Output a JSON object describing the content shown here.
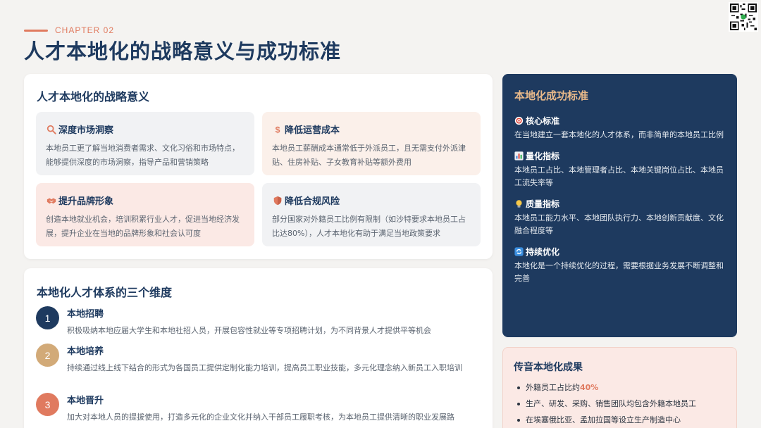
{
  "header": {
    "chapter": "CHAPTER 02",
    "title": "人才本地化的战略意义与成功标准"
  },
  "strategy": {
    "title": "人才本地化的战略意义",
    "tiles": [
      {
        "icon": "magnifier-icon",
        "title": "深度市场洞察",
        "desc": "本地员工更了解当地消费者需求、文化习俗和市场特点，能够提供深度的市场洞察，指导产品和营销策略"
      },
      {
        "icon": "dollar-icon",
        "title": "降低运营成本",
        "desc": "本地员工薪酬成本通常低于外派员工，且无需支付外派津贴、住房补贴、子女教育补贴等额外费用"
      },
      {
        "icon": "handshake-icon",
        "title": "提升品牌形象",
        "desc": "创造本地就业机会，培训积累行业人才，促进当地经济发展，提升企业在当地的品牌形象和社会认可度"
      },
      {
        "icon": "shield-icon",
        "title": "降低合规风险",
        "desc": "部分国家对外籍员工比例有限制（如沙特要求本地员工占比达80%），人才本地化有助于满足当地政策要求"
      }
    ]
  },
  "dimensions": {
    "title": "本地化人才体系的三个维度",
    "items": [
      {
        "num": "1",
        "title": "本地招聘",
        "desc": "积极吸纳本地应届大学生和本地社招人员，开展包容性就业等专项招聘计划，为不同背景人才提供平等机会"
      },
      {
        "num": "2",
        "title": "本地培养",
        "desc": "持续通过线上线下结合的形式为各国员工提供定制化能力培训，提高员工职业技能，多元化理念纳入新员工入职培训"
      },
      {
        "num": "3",
        "title": "本地晋升",
        "desc": "加大对本地人员的提拔使用，打造多元化的企业文化并纳入干部员工履职考核，为本地员工提供清晰的职业发展路"
      }
    ]
  },
  "standards": {
    "title": "本地化成功标准",
    "items": [
      {
        "icon": "target-icon",
        "title": "核心标准",
        "desc": "在当地建立一套本地化的人才体系，而非简单的本地员工比例"
      },
      {
        "icon": "bar-chart-icon",
        "title": "量化指标",
        "desc": "本地员工占比、本地管理者占比、本地关键岗位占比、本地员工流失率等"
      },
      {
        "icon": "lightbulb-icon",
        "title": "质量指标",
        "desc": "本地员工能力水平、本地团队执行力、本地创新贡献度、文化融合程度等"
      },
      {
        "icon": "refresh-icon",
        "title": "持续优化",
        "desc": "本地化是一个持续优化的过程，需要根据业务发展不断调整和完善"
      }
    ]
  },
  "achievements": {
    "title": "传音本地化成果",
    "item1_prefix": "外籍员工占比约",
    "item1_value": "40%",
    "item2": "生产、研发、采购、销售团队均包含外籍本地员工",
    "item3": "在埃塞俄比亚、孟加拉国等设立生产制造中心"
  }
}
